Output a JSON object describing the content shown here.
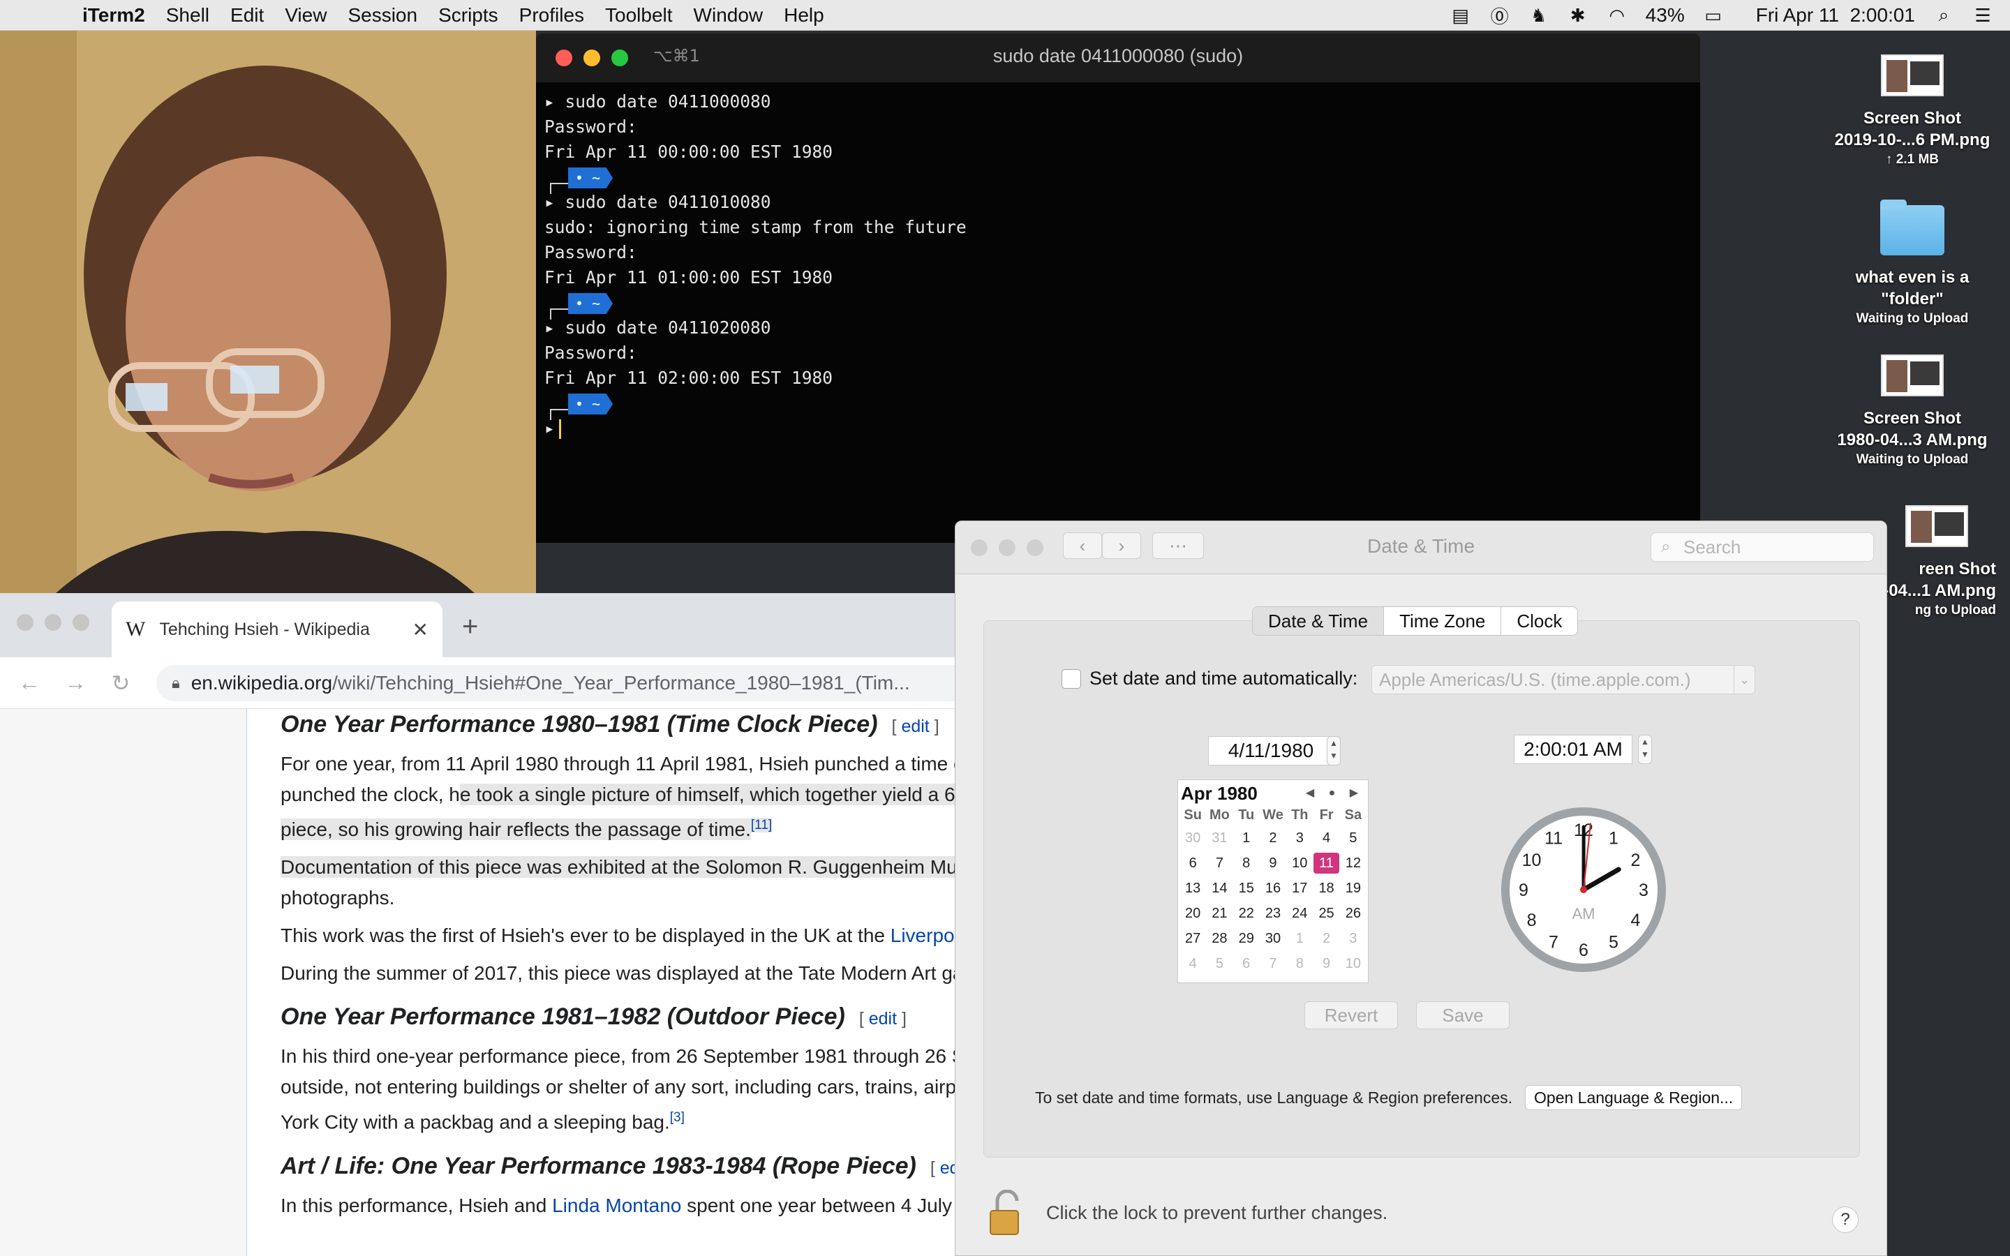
{
  "menubar": {
    "app_name": "iTerm2",
    "items": [
      "Shell",
      "Edit",
      "View",
      "Session",
      "Scripts",
      "Profiles",
      "Toolbelt",
      "Window",
      "Help"
    ],
    "battery": "43%",
    "datetime": "Fri Apr 11  2:00:01"
  },
  "terminal": {
    "shortcut": "⌥⌘1",
    "title": "sudo date 0411000080 (sudo)",
    "prompt_symbol": "▸",
    "pill_text": "• ~",
    "lines": {
      "l1": "sudo date 0411000080",
      "l2": "Password:",
      "l3": "Fri Apr 11 00:00:00 EST 1980",
      "l4": "sudo date 0411010080",
      "l5": "sudo: ignoring time stamp from the future",
      "l6": "Password:",
      "l7": "Fri Apr 11 01:00:00 EST 1980",
      "l8": "sudo date 0411020080",
      "l9": "Password:",
      "l10": "Fri Apr 11 02:00:00 EST 1980"
    }
  },
  "desktop": {
    "items": [
      {
        "name": "Screen Shot\n2019-10-...6 PM.png",
        "status": "↑ 2.1 MB"
      },
      {
        "name": "what even is a\n\"folder\"",
        "status": "Waiting to Upload"
      },
      {
        "name": "Screen Shot\n1980-04...3 AM.png",
        "status": "Waiting to Upload"
      },
      {
        "name": "reen Shot\n-04...1 AM.png",
        "status": "ng to Upload"
      }
    ]
  },
  "browser": {
    "tab_title": "Tehching Hsieh - Wikipedia",
    "url_domain": "en.wikipedia.org",
    "url_path": "/wiki/Tehching_Hsieh#One_Year_Performance_1980–1981_(Tim...",
    "content": {
      "h1": "One Year Performance 1980–1981 (Time Clock Piece)",
      "edit": "edit",
      "p1a": "For one year, from 11 April 1980 through 11 April 1981, Hsieh punched a time c",
      "p1b_pre": "punched the clock, h",
      "p1b_hl": "e took a single picture of himself, which together yield a 6",
      "p1c_hl": "piece, so his growing hair reflects the passage of time.",
      "ref11": "[11]",
      "p2a": "Documentation of this piece was exhibited at the Solomon R. Guggenheim Mu",
      "p2b": "photographs.",
      "p3_pre": "This work was the first of Hsieh's ever to be displayed in the UK at the ",
      "p3_link": "Liverpo",
      "p4": "During the summer of 2017, this piece was displayed at the Tate Modern Art ga",
      "h2": "One Year Performance 1981–1982 (Outdoor Piece)",
      "p5a": "In his third one-year performance piece, from 26 September 1981 through 26 S",
      "p5b": "outside, not entering buildings or shelter of any sort, including cars, trains, airp",
      "p5c": "York City with a packbag and a sleeping bag.",
      "ref3": "[3]",
      "h3": "Art / Life: One Year Performance 1983-1984 (Rope Piece)",
      "edit_cut": "ed",
      "p6_pre": "In this performance, Hsieh and ",
      "p6_link": "Linda Montano",
      "p6_post": " spent one year between 4 July"
    }
  },
  "prefs": {
    "title": "Date & Time",
    "search_placeholder": "Search",
    "tabs": [
      "Date & Time",
      "Time Zone",
      "Clock"
    ],
    "auto_label": "Set date and time automatically:",
    "server": "Apple Americas/U.S. (time.apple.com.)",
    "date_value": "4/11/1980",
    "time_value": "2:00:01 AM",
    "calendar": {
      "month": "Apr 1980",
      "nav": "◀ ● ▶",
      "weekdays": [
        "Su",
        "Mo",
        "Tu",
        "We",
        "Th",
        "Fr",
        "Sa"
      ],
      "days": [
        "30",
        "31",
        "1",
        "2",
        "3",
        "4",
        "5",
        "6",
        "7",
        "8",
        "9",
        "10",
        "11",
        "12",
        "13",
        "14",
        "15",
        "16",
        "17",
        "18",
        "19",
        "20",
        "21",
        "22",
        "23",
        "24",
        "25",
        "26",
        "27",
        "28",
        "29",
        "30",
        "1",
        "2",
        "3",
        "4",
        "5",
        "6",
        "7",
        "8",
        "9",
        "10"
      ],
      "selected": "11"
    },
    "clock_value": {
      "hour": 2,
      "minute": 0,
      "second": 1
    },
    "clock_am": "AM",
    "revert": "Revert",
    "save": "Save",
    "formats_text": "To set date and time formats, use Language & Region preferences.",
    "lang_button": "Open Language & Region...",
    "lock_text": "Click the lock to prevent further changes.",
    "help": "?"
  }
}
